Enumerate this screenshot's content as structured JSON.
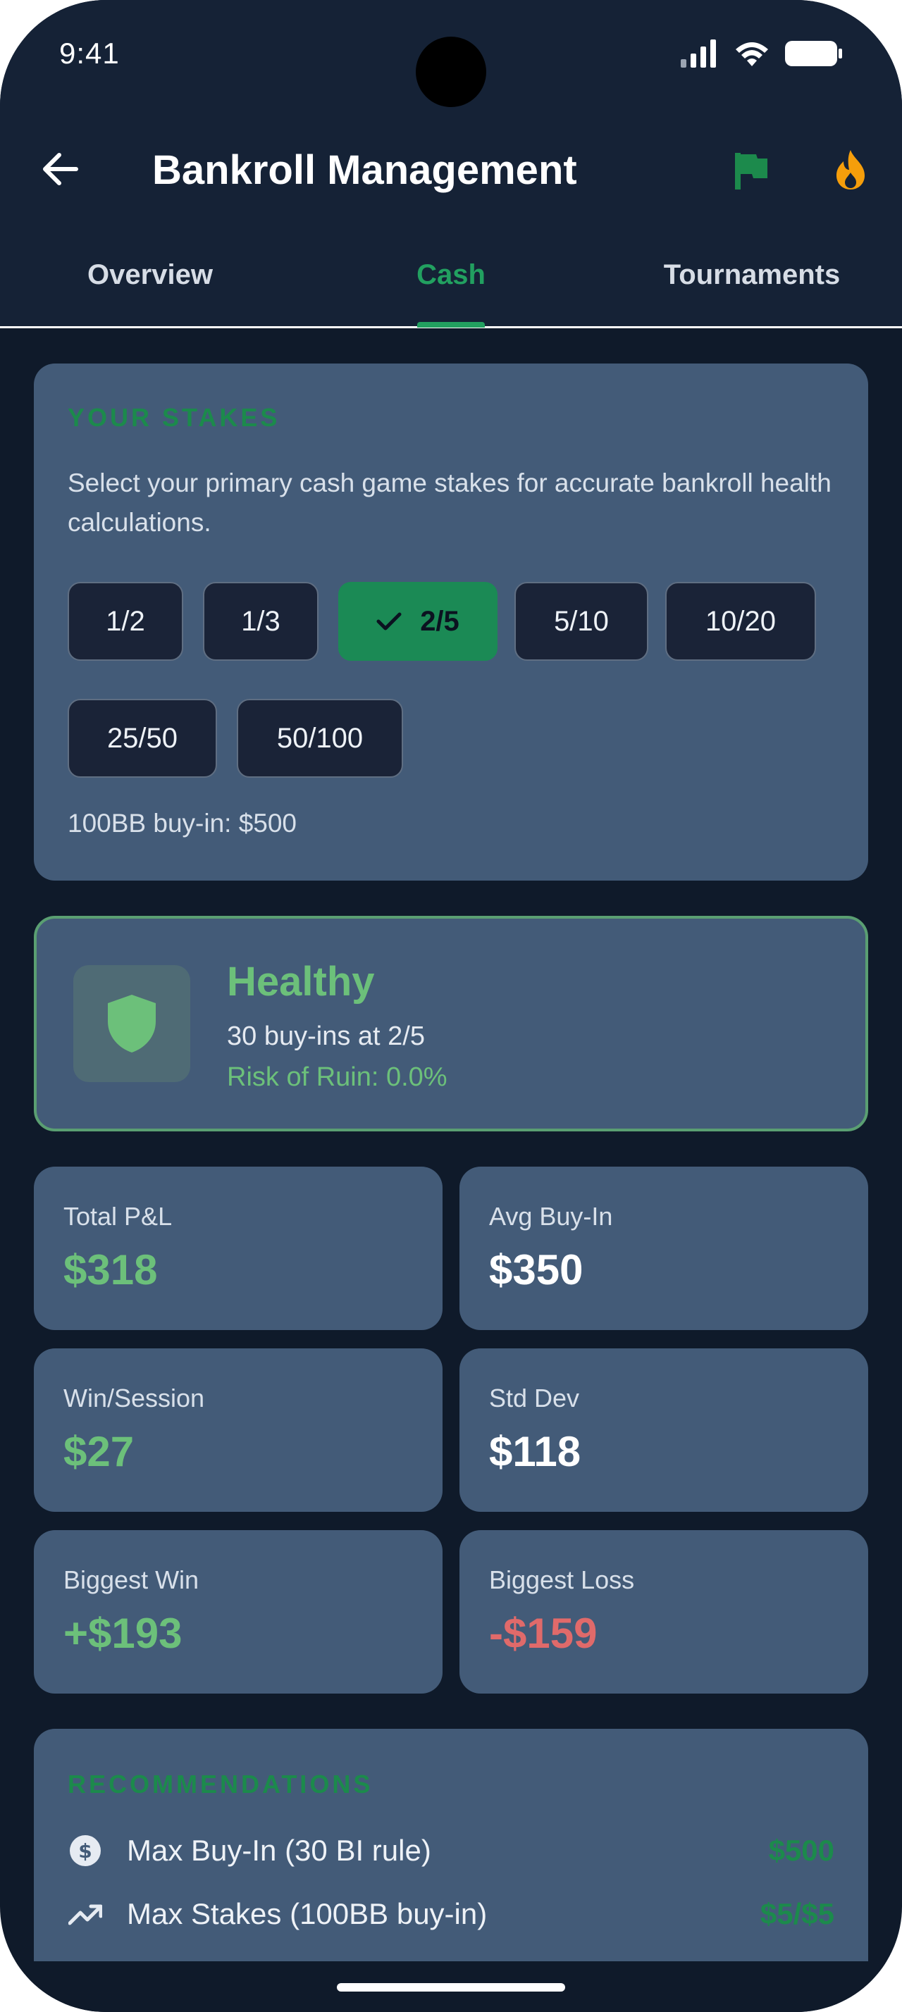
{
  "status_bar": {
    "time": "9:41"
  },
  "app_bar": {
    "title": "Bankroll Management"
  },
  "tabs": [
    {
      "label": "Overview",
      "active": false
    },
    {
      "label": "Cash",
      "active": true
    },
    {
      "label": "Tournaments",
      "active": false
    }
  ],
  "stakes": {
    "section_title": "YOUR STAKES",
    "description": "Select your primary cash game stakes for accurate bankroll health calculations.",
    "options": [
      "1/2",
      "1/3",
      "2/5",
      "5/10",
      "10/20",
      "25/50",
      "50/100"
    ],
    "selected": "2/5",
    "buyin_note": "100BB buy-in: $500"
  },
  "health": {
    "status": "Healthy",
    "buyins": "30 buy-ins at 2/5",
    "risk_of_ruin": "Risk of Ruin: 0.0%"
  },
  "stats": [
    {
      "label": "Total P&L",
      "value": "$318",
      "tone": "positive"
    },
    {
      "label": "Avg Buy-In",
      "value": "$350",
      "tone": "neutral"
    },
    {
      "label": "Win/Session",
      "value": "$27",
      "tone": "positive"
    },
    {
      "label": "Std Dev",
      "value": "$118",
      "tone": "neutral"
    },
    {
      "label": "Biggest Win",
      "value": "+$193",
      "tone": "positive"
    },
    {
      "label": "Biggest Loss",
      "value": "-$159",
      "tone": "negative"
    }
  ],
  "recommendations": {
    "section_title": "RECOMMENDATIONS",
    "items": [
      {
        "icon": "dollar-circle-icon",
        "label": "Max Buy-In (30 BI rule)",
        "value": "$500"
      },
      {
        "icon": "trending-up-icon",
        "label": "Max Stakes (100BB buy-in)",
        "value": "$5/$5"
      }
    ]
  },
  "colors": {
    "accent_green": "#22a060",
    "positive": "#6cc07a",
    "negative": "#e06a6a",
    "card_bg": "#435b78",
    "page_bg": "#0f1a2a",
    "flame": "#f59e0b"
  }
}
